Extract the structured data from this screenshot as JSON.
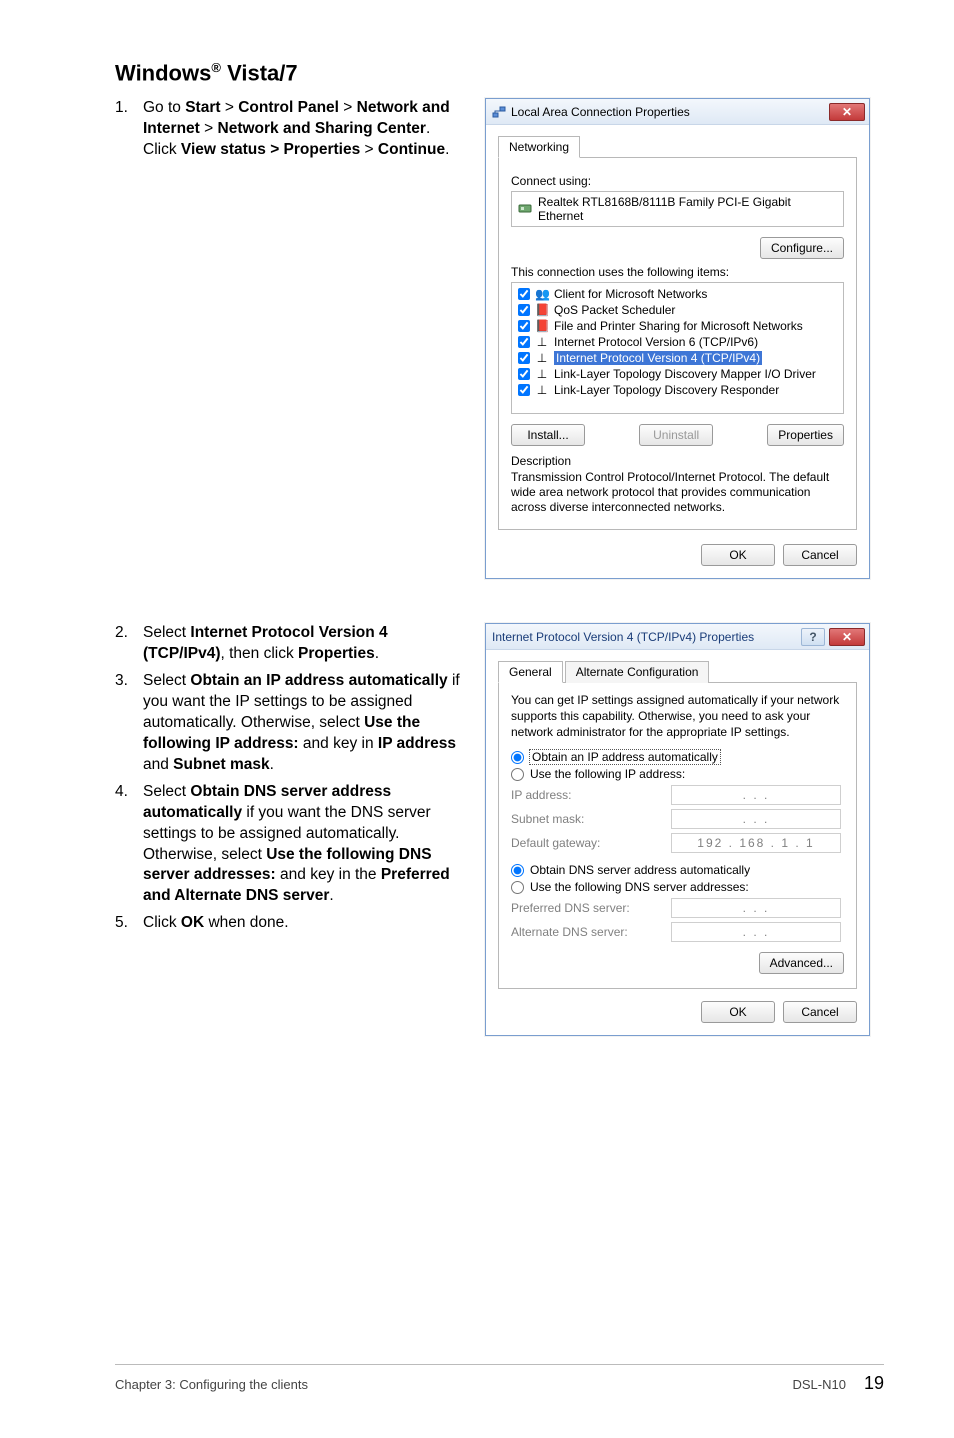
{
  "heading_prefix": "Windows",
  "heading_reg": "®",
  "heading_suffix": " Vista/7",
  "steps1": {
    "num": "1.",
    "text_parts": [
      "Go to ",
      "Start",
      " > ",
      "Control Panel",
      " > ",
      "Network and Internet",
      " > ",
      "Network and Sharing Center",
      ". Click ",
      "View status > Properties",
      " > ",
      "Continue",
      "."
    ]
  },
  "steps2": [
    {
      "num": "2.",
      "plain": "Select ",
      "bold1": "Internet Protocol Version 4 (TCP/IPv4)",
      "mid": ", then click ",
      "bold2": "Properties",
      "end": "."
    },
    {
      "num": "3.",
      "plain": "Select ",
      "bold1": "Obtain an IP address automatically",
      "mid": " if you want the IP settings to be assigned automatically. Otherwise, select ",
      "bold2": "Use the following IP address:",
      "mid2": " and key in ",
      "bold3": "IP address",
      "mid3": " and ",
      "bold4": "Subnet mask",
      "end": "."
    },
    {
      "num": "4.",
      "plain": "Select ",
      "bold1": "Obtain DNS server address automatically",
      "mid": " if you want the DNS server settings to be assigned automatically. Otherwise, select ",
      "bold2": "Use the following DNS server addresses:",
      "mid2": " and key in the ",
      "bold3": "Preferred and Alternate DNS server",
      "end": "."
    },
    {
      "num": "5.",
      "plain": "Click ",
      "bold1": "OK",
      "end": " when done."
    }
  ],
  "dlg1": {
    "title": "Local Area Connection Properties",
    "tab": "Networking",
    "connect_using_label": "Connect using:",
    "adapter": "Realtek RTL8168B/8111B Family PCI-E Gigabit Ethernet",
    "configure": "Configure...",
    "uses_label": "This connection uses the following items:",
    "items": [
      {
        "icon": "👥",
        "label": "Client for Microsoft Networks"
      },
      {
        "icon": "📕",
        "label": "QoS Packet Scheduler"
      },
      {
        "icon": "📕",
        "label": "File and Printer Sharing for Microsoft Networks"
      },
      {
        "icon": "⊥",
        "label": "Internet Protocol Version 6 (TCP/IPv6)"
      },
      {
        "icon": "⊥",
        "label": "Internet Protocol Version 4 (TCP/IPv4)",
        "selected": true
      },
      {
        "icon": "⊥",
        "label": "Link-Layer Topology Discovery Mapper I/O Driver"
      },
      {
        "icon": "⊥",
        "label": "Link-Layer Topology Discovery Responder"
      }
    ],
    "install": "Install...",
    "uninstall": "Uninstall",
    "properties": "Properties",
    "desc_label": "Description",
    "desc_text": "Transmission Control Protocol/Internet Protocol. The default wide area network protocol that provides communication across diverse interconnected networks.",
    "ok": "OK",
    "cancel": "Cancel"
  },
  "dlg2": {
    "title": "Internet Protocol Version 4 (TCP/IPv4) Properties",
    "tab_general": "General",
    "tab_alt": "Alternate Configuration",
    "intro": "You can get IP settings assigned automatically if your network supports this capability. Otherwise, you need to ask your network administrator for the appropriate IP settings.",
    "r_obtain_ip": "Obtain an IP address automatically",
    "r_use_ip": "Use the following IP address:",
    "ip_label": "IP address:",
    "subnet_label": "Subnet mask:",
    "gateway_label": "Default gateway:",
    "gateway_value": "192 . 168 .  1  .  1",
    "r_obtain_dns": "Obtain DNS server address automatically",
    "r_use_dns": "Use the following DNS server addresses:",
    "pref_dns": "Preferred DNS server:",
    "alt_dns": "Alternate DNS server:",
    "advanced": "Advanced...",
    "ok": "OK",
    "cancel": "Cancel",
    "dots": ".     .     ."
  },
  "footer": {
    "left": "Chapter 3: Configuring the clients",
    "model": "DSL-N10",
    "page": "19"
  }
}
